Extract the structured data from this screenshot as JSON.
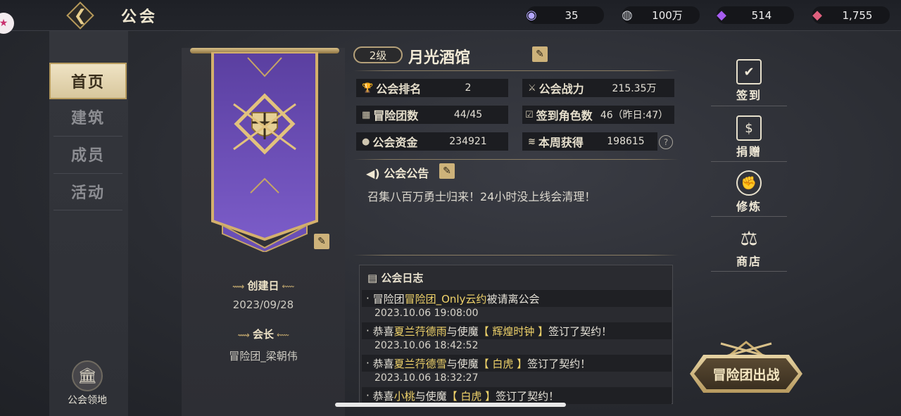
{
  "header": {
    "title": "公会",
    "back_icon": "back-arrow-icon",
    "currencies": [
      {
        "icon": "ticket-plus-icon",
        "value": "35",
        "color": "#b5a8ff"
      },
      {
        "icon": "silver-coin-plus-icon",
        "value": "100万",
        "color": "#c9ccd2"
      },
      {
        "icon": "purple-gem-icon",
        "value": "514",
        "color": "#a65cf0"
      },
      {
        "icon": "pink-gem-plus-icon",
        "value": "1,755",
        "color": "#e0607e"
      }
    ]
  },
  "nav": {
    "items": [
      {
        "label": "首页",
        "active": true
      },
      {
        "label": "建筑",
        "active": false
      },
      {
        "label": "成员",
        "active": false
      },
      {
        "label": "活动",
        "active": false
      }
    ],
    "territory_label": "公会领地"
  },
  "banner": {
    "created_label": "创建日",
    "created_date": "2023/09/28",
    "leader_label": "会长",
    "leader_name": "冒险团_梁朝伟",
    "banner_color": "#6b4fb3"
  },
  "guild": {
    "level": "2级",
    "name": "月光酒馆",
    "stats": [
      {
        "label": "公会排名",
        "value": "2",
        "icon": "trophy-icon"
      },
      {
        "label": "公会战力",
        "value": "215.35万",
        "icon": "crossed-swords-icon"
      },
      {
        "label": "冒险团数",
        "value": "44/45",
        "icon": "team-icon"
      },
      {
        "label": "签到角色数",
        "value": "46（昨日:47）",
        "icon": "checkin-icon"
      },
      {
        "label": "公会资金",
        "value": "234921",
        "icon": "money-bag-icon"
      },
      {
        "label": "本周获得",
        "value": "198615",
        "icon": "coin-stack-icon"
      }
    ],
    "notice_title": "公会公告",
    "notice_text": "召集八百万勇士归来！24小时没上线会清理！"
  },
  "log": {
    "title": "公会日志",
    "entries": [
      {
        "bullet": "·",
        "pre": "冒险团",
        "hl1": "冒险团_Only云约",
        "mid": "被请离公会",
        "hl2": "",
        "post": "",
        "time": "2023.10.06 19:08:00"
      },
      {
        "bullet": "·",
        "pre": "恭喜",
        "hl1": "夏兰荇德雨",
        "mid": "与使魔",
        "hl2": "【 辉煌时钟 】",
        "post": "签订了契约！",
        "time": "2023.10.06 18:42:52"
      },
      {
        "bullet": "·",
        "pre": "恭喜",
        "hl1": "夏兰荇德雪",
        "mid": "与使魔",
        "hl2": "【 白虎 】",
        "post": "签订了契约！",
        "time": "2023.10.06 18:32:27"
      },
      {
        "bullet": "·",
        "pre": "恭喜",
        "hl1": "小桃",
        "mid": "与使魔",
        "hl2": "【 白虎 】",
        "post": "签订了契约！",
        "time": ""
      }
    ]
  },
  "actions": [
    {
      "label": "签到",
      "icon": "calendar-check-icon",
      "glyph": "✔"
    },
    {
      "label": "捐赠",
      "icon": "donate-icon",
      "glyph": "$"
    },
    {
      "label": "修炼",
      "icon": "fist-icon",
      "glyph": "✊"
    },
    {
      "label": "商店",
      "icon": "scales-icon",
      "glyph": "⚖"
    }
  ],
  "battle_button": "冒险团出战"
}
